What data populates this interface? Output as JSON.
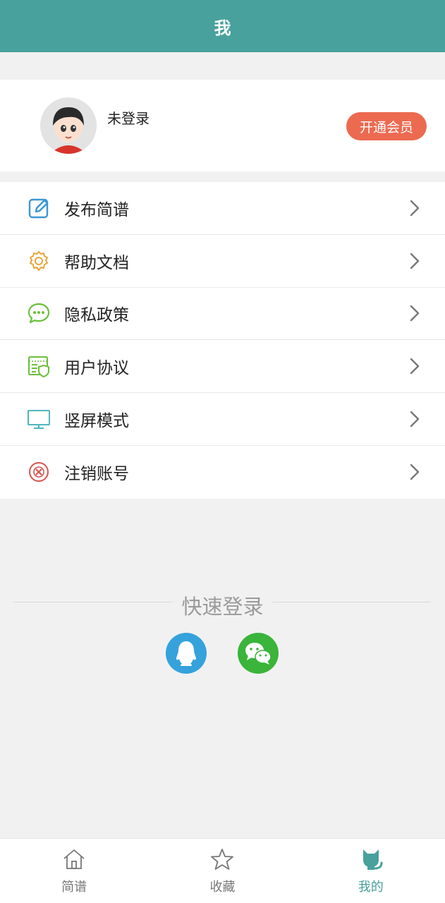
{
  "header": {
    "title": "我"
  },
  "profile": {
    "status": "未登录",
    "vip_button": "开通会员"
  },
  "menu": {
    "items": [
      {
        "label": "发布简谱",
        "icon": "edit-icon",
        "color": "#3a97d4"
      },
      {
        "label": "帮助文档",
        "icon": "gear-icon",
        "color": "#e8a53a"
      },
      {
        "label": "隐私政策",
        "icon": "chat-icon",
        "color": "#6cbf3b"
      },
      {
        "label": "用户协议",
        "icon": "document-shield-icon",
        "color": "#6cbf3b"
      },
      {
        "label": "竖屏模式",
        "icon": "monitor-icon",
        "color": "#4fb7bd"
      },
      {
        "label": "注销账号",
        "icon": "close-circle-icon",
        "color": "#d9534f"
      }
    ]
  },
  "quick_login": {
    "title": "快速登录",
    "options": [
      "qq-icon",
      "wechat-icon"
    ]
  },
  "tabbar": {
    "tabs": [
      {
        "label": "简谱",
        "icon": "home-icon"
      },
      {
        "label": "收藏",
        "icon": "star-icon"
      },
      {
        "label": "我的",
        "icon": "cat-icon",
        "active": true
      }
    ]
  },
  "colors": {
    "primary": "#48a19c",
    "vip": "#ec6a50",
    "qq": "#35a2dc",
    "wechat": "#3ab43a"
  }
}
